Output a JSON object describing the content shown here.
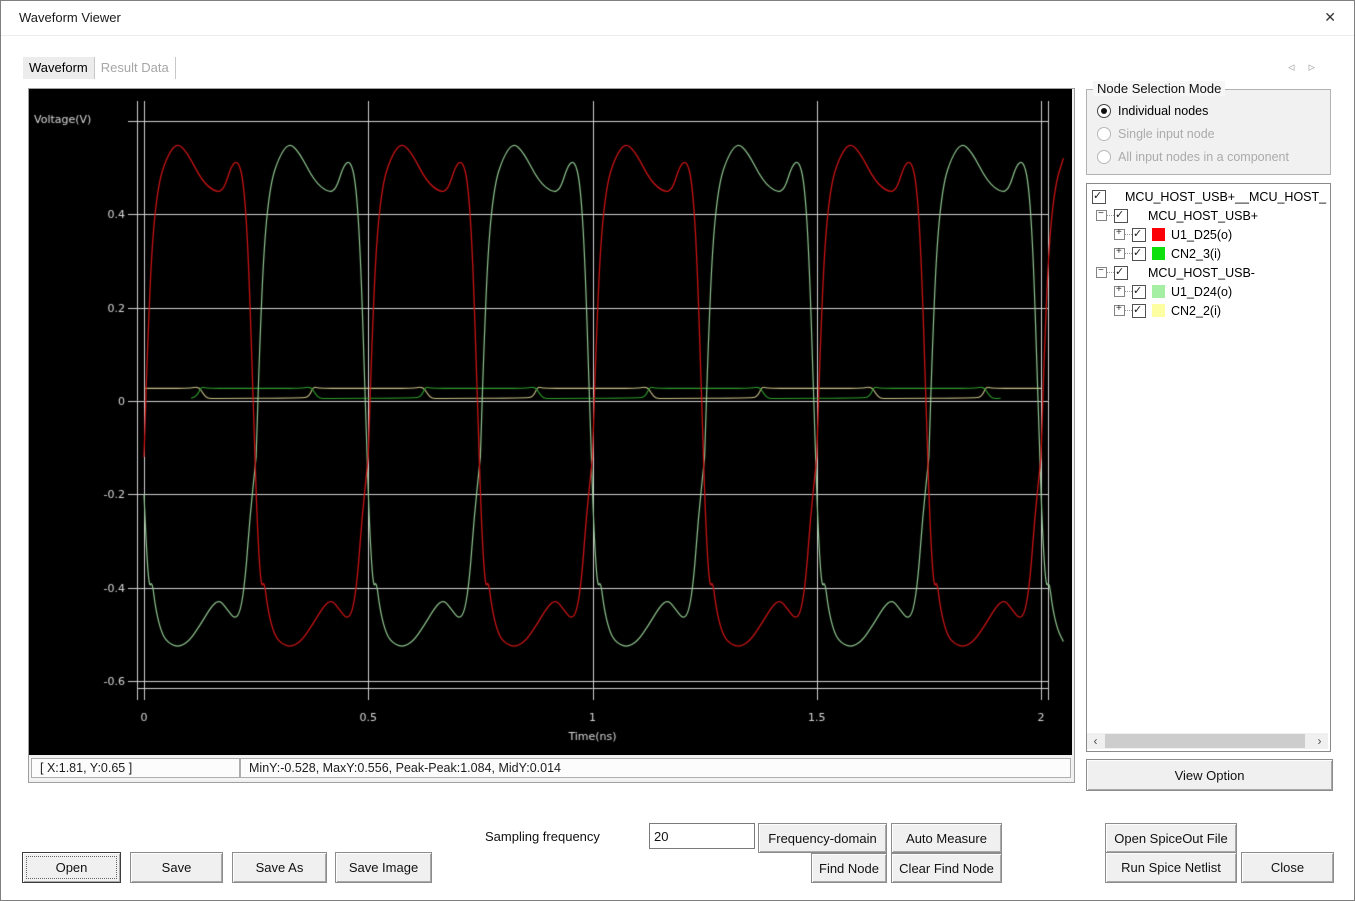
{
  "window": {
    "title": "Waveform Viewer"
  },
  "icons": {
    "close": "✕",
    "tab_prev": "◃",
    "tab_next": "▹",
    "scroll_left": "‹",
    "scroll_right": "›"
  },
  "tabs": {
    "waveform": "Waveform",
    "result_data": "Result Data"
  },
  "status": {
    "cursor": "[ X:1.81, Y:0.65 ]",
    "measure": "MinY:-0.528, MaxY:0.556, Peak-Peak:1.084, MidY:0.014"
  },
  "node_selection": {
    "legend": "Node Selection Mode",
    "options": [
      {
        "label": "Individual nodes",
        "selected": true,
        "enabled": true
      },
      {
        "label": "Single input node",
        "selected": false,
        "enabled": false
      },
      {
        "label": "All input nodes in a component",
        "selected": false,
        "enabled": false
      }
    ]
  },
  "tree": {
    "root": "MCU_HOST_USB+__MCU_HOST_",
    "groups": [
      {
        "label": "MCU_HOST_USB+",
        "children": [
          {
            "label": "U1_D25(o)",
            "swatch": "#fb0007"
          },
          {
            "label": "CN2_3(i)",
            "swatch": "#0ee00e"
          }
        ]
      },
      {
        "label": "MCU_HOST_USB-",
        "children": [
          {
            "label": "U1_D24(o)",
            "swatch": "#a5efa5"
          },
          {
            "label": "CN2_2(i)",
            "swatch": "#fdfda2"
          }
        ]
      }
    ]
  },
  "sampling": {
    "label": "Sampling frequency",
    "value": "20"
  },
  "toolbar": {
    "open": "Open",
    "save": "Save",
    "save_as": "Save As",
    "save_image": "Save Image",
    "frequency_domain": "Frequency-domain",
    "auto_measure": "Auto Measure",
    "find_node": "Find Node",
    "clear_find_node": "Clear Find Node",
    "view_option": "View Option",
    "open_spiceout": "Open SpiceOut File",
    "run_spice": "Run Spice Netlist",
    "close": "Close"
  },
  "chart_data": {
    "type": "line",
    "xlabel": "Time(ns)",
    "ylabel": "Voltage(V)",
    "xlim": [
      0,
      2.07
    ],
    "ylim": [
      -0.65,
      0.64
    ],
    "grid": true,
    "background": "#000000",
    "grid_color": "#cfcfcf",
    "xticks": [
      {
        "v": 0,
        "label": "0"
      },
      {
        "v": 0.5,
        "label": "0.5"
      },
      {
        "v": 1,
        "label": "1"
      },
      {
        "v": 1.5,
        "label": "1.5"
      },
      {
        "v": 2,
        "label": "2"
      }
    ],
    "yticks": [
      {
        "v": 0.4,
        "label": "0.4"
      },
      {
        "v": 0.2,
        "label": "0.2"
      },
      {
        "v": 0,
        "label": "0"
      },
      {
        "v": -0.2,
        "label": "-0.2"
      },
      {
        "v": -0.4,
        "label": "-0.4"
      },
      {
        "v": -0.6,
        "label": "-0.6"
      }
    ],
    "y_gridlines": [
      0.6,
      0.4,
      0.2,
      0,
      -0.2,
      -0.4,
      -0.6
    ],
    "period_ns": 0.5,
    "shapes": {
      "driver": [
        [
          0,
          -0.12
        ],
        [
          0.008,
          0.12
        ],
        [
          0.018,
          0.34
        ],
        [
          0.032,
          0.465
        ],
        [
          0.05,
          0.52
        ],
        [
          0.072,
          0.553
        ],
        [
          0.095,
          0.535
        ],
        [
          0.13,
          0.47
        ],
        [
          0.16,
          0.447
        ],
        [
          0.178,
          0.452
        ],
        [
          0.195,
          0.505
        ],
        [
          0.21,
          0.515
        ],
        [
          0.222,
          0.47
        ],
        [
          0.232,
          0.33
        ],
        [
          0.242,
          0.05
        ],
        [
          0.25,
          -0.2
        ],
        [
          0.256,
          -0.33
        ],
        [
          0.262,
          -0.4
        ],
        [
          0.268,
          -0.385
        ],
        [
          0.276,
          -0.445
        ],
        [
          0.287,
          -0.49
        ],
        [
          0.3,
          -0.515
        ],
        [
          0.325,
          -0.528
        ],
        [
          0.35,
          -0.515
        ],
        [
          0.375,
          -0.48
        ],
        [
          0.4,
          -0.44
        ],
        [
          0.418,
          -0.425
        ],
        [
          0.436,
          -0.447
        ],
        [
          0.452,
          -0.467
        ],
        [
          0.465,
          -0.452
        ],
        [
          0.476,
          -0.38
        ],
        [
          0.486,
          -0.25
        ],
        [
          0.5,
          -0.12
        ]
      ],
      "receiver": [
        [
          0,
          0.027
        ],
        [
          0.1,
          0.027
        ],
        [
          0.122,
          0.031
        ],
        [
          0.132,
          0.015
        ],
        [
          0.142,
          0.005
        ],
        [
          0.16,
          0.006
        ],
        [
          0.355,
          0.006
        ],
        [
          0.368,
          0.01
        ],
        [
          0.378,
          0.031
        ],
        [
          0.39,
          0.027
        ],
        [
          0.5,
          0.027
        ]
      ]
    },
    "series": [
      {
        "name": "CN2_2(i)",
        "color": "#c9c08a",
        "shape": "receiver",
        "phase": 0,
        "width": 1.1
      },
      {
        "name": "CN2_3(i)",
        "color": "#2f9e2f",
        "shape": "receiver",
        "phase": 0.25,
        "width": 1.1
      },
      {
        "name": "U1_D24(o)",
        "color": "#8fc48f",
        "shape": "driver",
        "phase": 0.25,
        "width": 1.2
      },
      {
        "name": "U1_D25(o)",
        "color": "#c81414",
        "shape": "driver",
        "phase": 0,
        "width": 1.3
      }
    ],
    "measurements": {
      "min_y": -0.528,
      "max_y": 0.556,
      "peak_peak": 1.084,
      "mid_y": 0.014
    }
  }
}
